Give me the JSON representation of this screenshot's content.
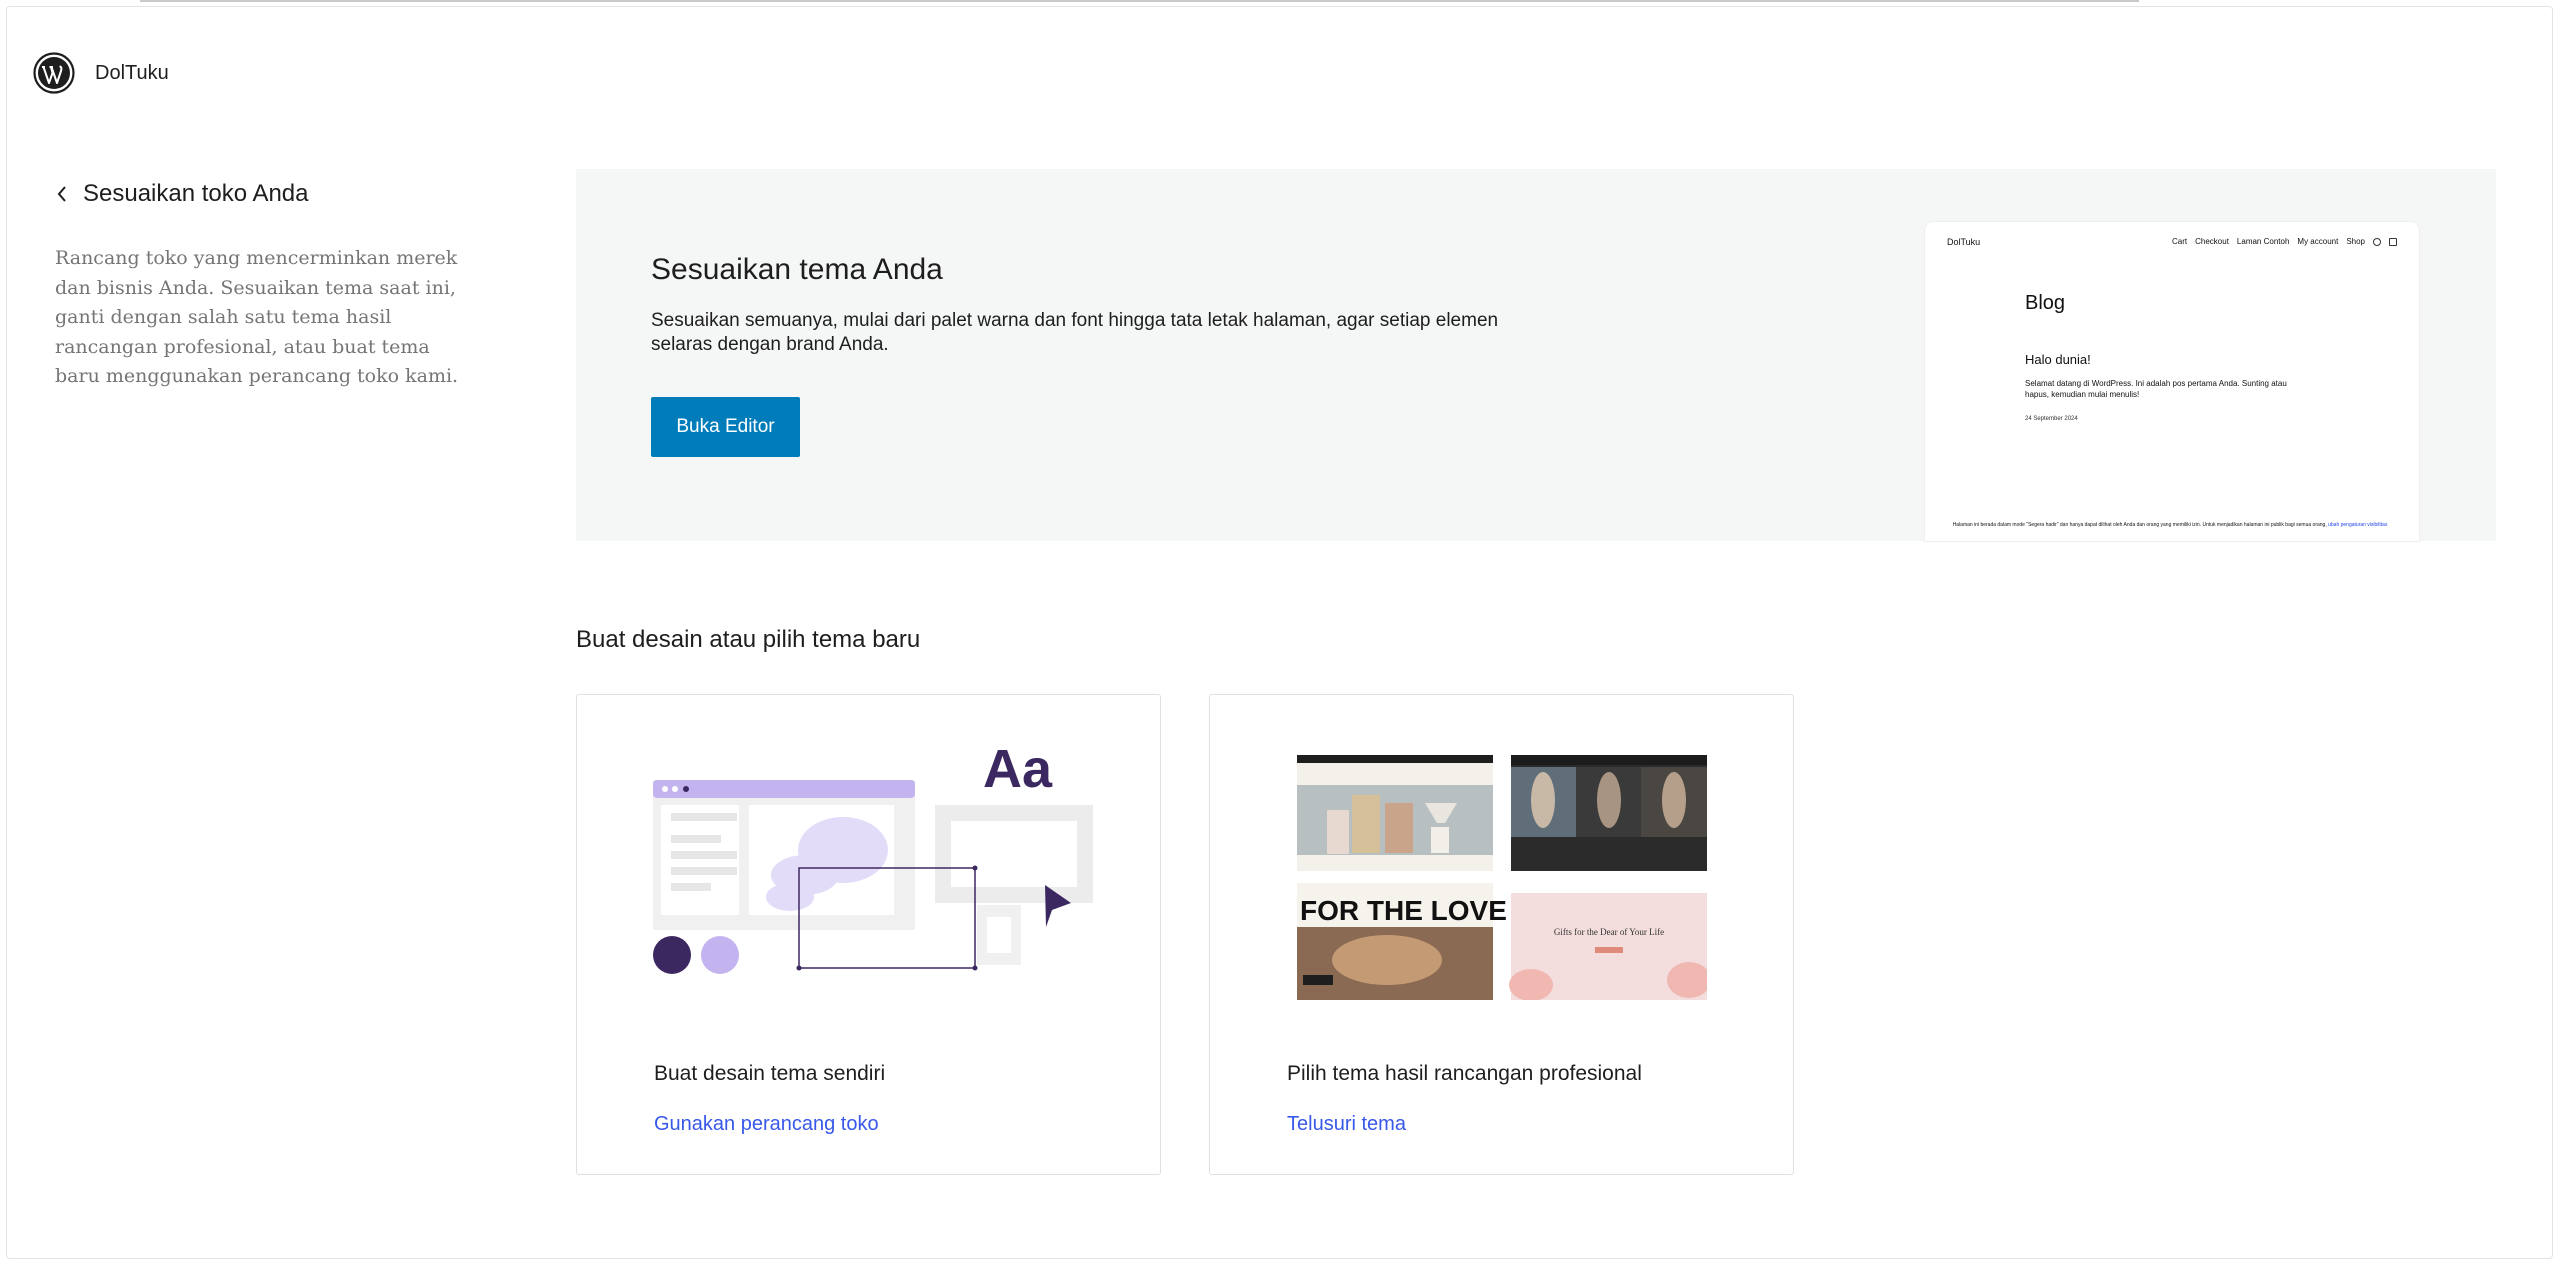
{
  "header": {
    "site_name": "DolTuku",
    "logo_icon": "wordpress-logo-icon"
  },
  "sidebar": {
    "back_label": "Sesuaikan toko Anda",
    "description": "Rancang toko yang mencerminkan merek dan bisnis Anda. Sesuaikan tema saat ini, ganti dengan salah satu tema hasil rancangan profesional, atau buat tema baru menggunakan perancang toko kami."
  },
  "hero": {
    "title": "Sesuaikan tema Anda",
    "description": "Sesuaikan semuanya, mulai dari palet warna dan font hingga tata letak halaman, agar setiap elemen selaras dengan brand Anda.",
    "button_label": "Buka Editor",
    "preview": {
      "site_name": "DolTuku",
      "nav": [
        "Cart",
        "Checkout",
        "Laman Contoh",
        "My account",
        "Shop"
      ],
      "blog_title": "Blog",
      "post_title": "Halo dunia!",
      "post_text": "Selamat datang di WordPress. Ini adalah pos pertama Anda. Sunting atau hapus, kemudian mulai menulis!",
      "post_date": "24 September 2024",
      "footer_text": "Halaman ini berada dalam mode \"Segera hadir\" dan hanya dapat dilihat oleh Anda dan orang yang memiliki izin. Untuk menjadikan halaman ini publik bagi semua orang,",
      "footer_link": "ubah pengaturan visibilitas"
    }
  },
  "section": {
    "title": "Buat desain atau pilih tema baru",
    "cards": [
      {
        "title": "Buat desain tema sendiri",
        "link": "Gunakan perancang toko"
      },
      {
        "title": "Pilih tema hasil rancangan profesional",
        "link": "Telusuri tema"
      }
    ],
    "illustration_text": "Aa",
    "theme_thumbnail_text": "FOR THE LOVE OF B",
    "theme_thumbnail_text2": "Gifts for the Dear of Your Life"
  },
  "colors": {
    "primary_button": "#007cba",
    "link": "#3858e9",
    "illustration_dark": "#3c2861",
    "illustration_light": "#c3b4f0"
  }
}
